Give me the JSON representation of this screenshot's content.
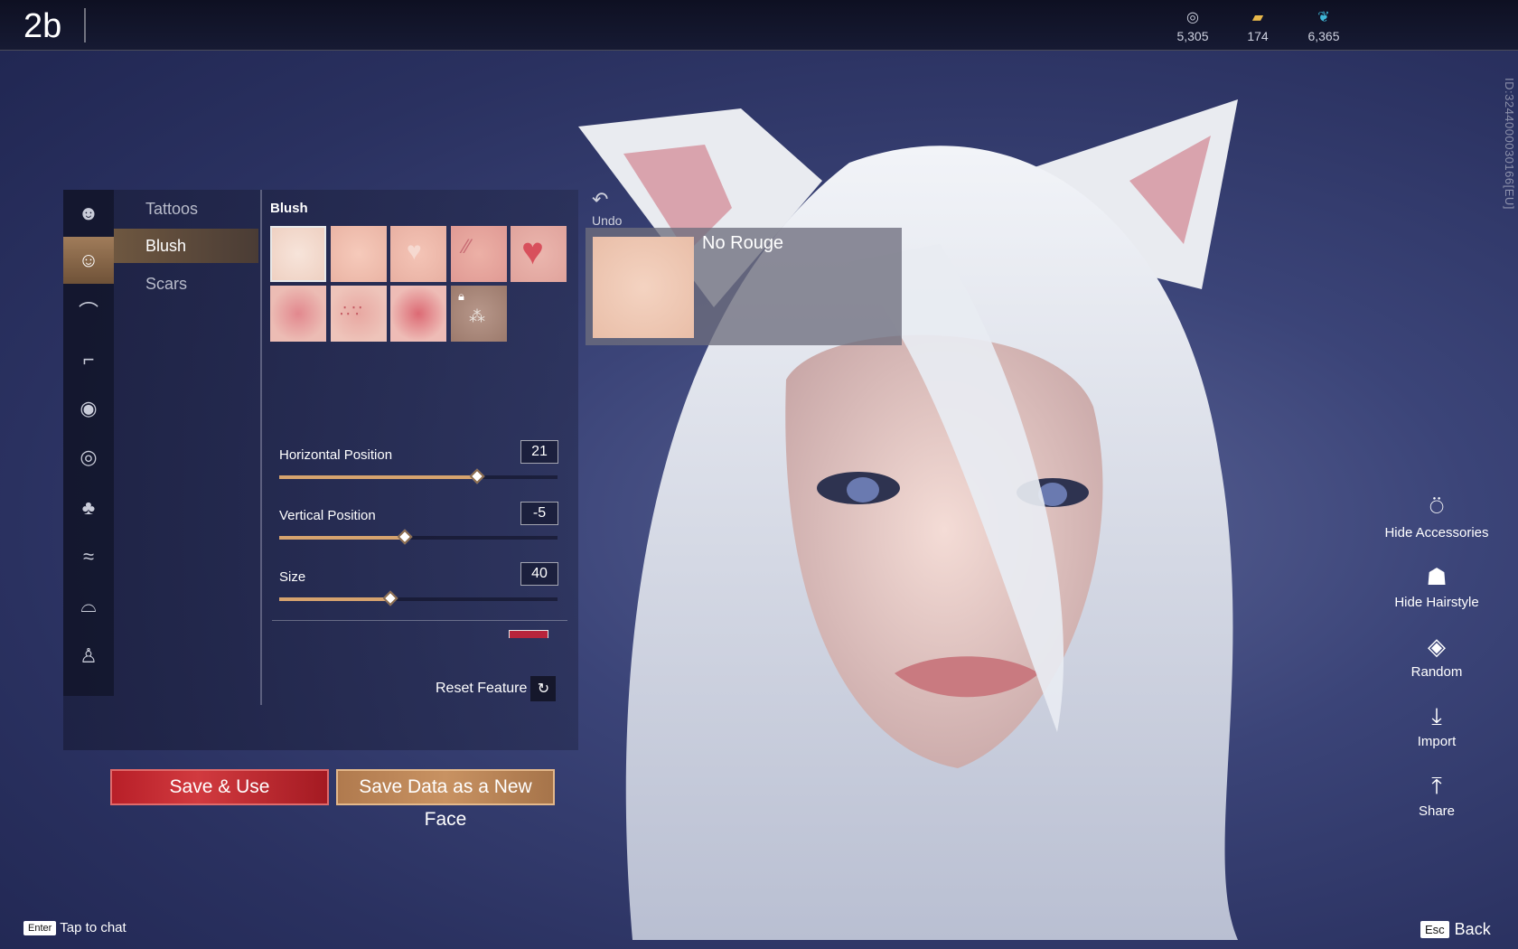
{
  "header": {
    "profile_name": "2b",
    "currencies": [
      {
        "icon": "silver-coins-icon",
        "value": "5,305"
      },
      {
        "icon": "gold-ticket-icon",
        "value": "174"
      },
      {
        "icon": "feather-icon",
        "value": "6,365"
      }
    ],
    "side_id": "ID:3244000030166[EU]"
  },
  "category_icons": [
    "face-shape-icon",
    "makeup-face-icon",
    "eyebrow-icon",
    "eyelash-icon",
    "eye-icon",
    "eye-detail-icon",
    "nose-icon",
    "lips-icon",
    "mouth-icon",
    "body-icon"
  ],
  "subcategories": [
    {
      "label": "Tattoos"
    },
    {
      "label": "Blush"
    },
    {
      "label": "Scars"
    }
  ],
  "blush": {
    "section_title": "Blush",
    "swatches": [
      {
        "color": "#f2d9cc",
        "style": "plain",
        "locked": false
      },
      {
        "color": "#f3c2b2",
        "style": "soft",
        "locked": false
      },
      {
        "color": "#f0bdb0",
        "style": "heart-small",
        "locked": false
      },
      {
        "color": "#efb0a6",
        "style": "scratch",
        "locked": false
      },
      {
        "color": "#e8aaa2",
        "style": "heart-big",
        "locked": false
      },
      {
        "color": "#e8a8a4",
        "style": "round",
        "locked": false
      },
      {
        "color": "#e6b0a4",
        "style": "freckles",
        "locked": false
      },
      {
        "color": "#e39b9c",
        "style": "dot",
        "locked": true
      },
      {
        "color": "#a88876",
        "style": "sparkle",
        "locked": true
      }
    ]
  },
  "sliders": [
    {
      "label": "Horizontal Position",
      "value": "21",
      "fraction": 0.71
    },
    {
      "label": "Vertical Position",
      "value": "-5",
      "fraction": 0.45
    },
    {
      "label": "Size",
      "value": "40",
      "fraction": 0.4
    }
  ],
  "color_row": {
    "color": "#b8253c"
  },
  "reset_feature": "Reset Feature",
  "undo": {
    "label": "Undo"
  },
  "preview": {
    "name": "No Rouge"
  },
  "actions": {
    "save_use": "Save & Use",
    "save_new": "Save Data as a New Face"
  },
  "tools": [
    {
      "icon": "accessory-icon",
      "label": "Hide Accessories"
    },
    {
      "icon": "hairstyle-icon",
      "label": "Hide Hairstyle"
    },
    {
      "icon": "dice-icon",
      "label": "Random"
    },
    {
      "icon": "import-icon",
      "label": "Import"
    },
    {
      "icon": "share-icon",
      "label": "Share"
    }
  ],
  "footer": {
    "chat_key": "Enter",
    "chat_label": "Tap to chat",
    "back_key": "Esc",
    "back_label": "Back"
  }
}
